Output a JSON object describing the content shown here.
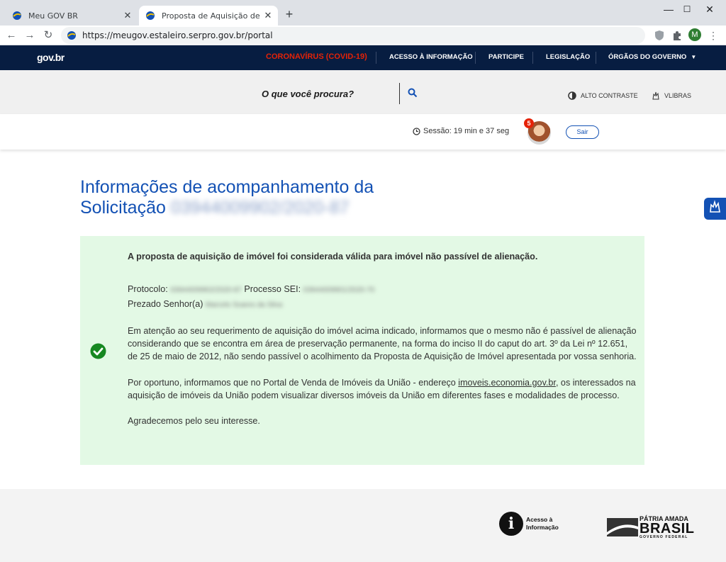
{
  "browser": {
    "tabs": [
      {
        "title": "Meu GOV BR",
        "active": false
      },
      {
        "title": "Proposta de Aquisição de Imóve",
        "active": true
      }
    ],
    "url": "https://meugov.estaleiro.serpro.gov.br/portal",
    "profile_initial": "M"
  },
  "govbar": {
    "logo": "gov.br",
    "links": [
      "CORONAVÍRUS (COVID-19)",
      "ACESSO À INFORMAÇÃO",
      "PARTICIPE",
      "LEGISLAÇÃO",
      "ÓRGÃOS DO GOVERNO"
    ]
  },
  "search": {
    "prompt": "O que você procura?",
    "alto_contraste": "ALTO CONTRASTE",
    "vlibras": "VLIBRAS"
  },
  "session": {
    "label": "Sessão: 19 min e 37 seg",
    "notification_count": "5",
    "logout": "Sair"
  },
  "main": {
    "title_line1": "Informações de acompanhamento da",
    "title_line2": "Solicitação",
    "request_id": "03944009902/2020-87"
  },
  "card": {
    "lead": "A proposta de aquisição de imóvel foi considerada válida para imóvel não passível de alienação.",
    "protocolo_label": "Protocolo:",
    "protocolo_value": "03944009902/2020-87",
    "processo_label": "Processo SEI:",
    "processo_value": "03944009901/2020-70",
    "prezado_label": "Prezado Senhor(a)",
    "prezado_value": "Marcelo Soares da Silva",
    "paragraph1": "Em atenção ao seu requerimento de aquisição do imóvel acima indicado, informamos que o mesmo não é passível de alienação considerando que se encontra em área de preservação permanente, na forma do inciso II do caput do art. 3º da Lei nº 12.651, de 25 de maio de 2012, não sendo passível o acolhimento da Proposta de Aquisição de Imóvel apresentada por vossa senhoria.",
    "paragraph2_start": "Por oportuno, informamos que no Portal de Venda de Imóveis da União - endereço ",
    "paragraph2_link": "imoveis.economia.gov.br",
    "paragraph2_end": ", os interessados na aquisição de imóveis da União podem visualizar diversos imóveis da União em diferentes fases e modalidades de processo.",
    "closing": "Agradecemos pelo seu interesse."
  },
  "footer": {
    "acesso_line1": "Acesso à",
    "acesso_line2": "Informação",
    "brasil_line1": "PÁTRIA AMADA",
    "brasil_line2": "BRASIL",
    "brasil_line3": "GOVERNO FEDERAL"
  },
  "colors": {
    "gov_navy": "#071d41",
    "gov_blue": "#1351b4",
    "covid_red": "#e52207",
    "success_bg": "#e3f9e5",
    "success_green": "#168821"
  }
}
